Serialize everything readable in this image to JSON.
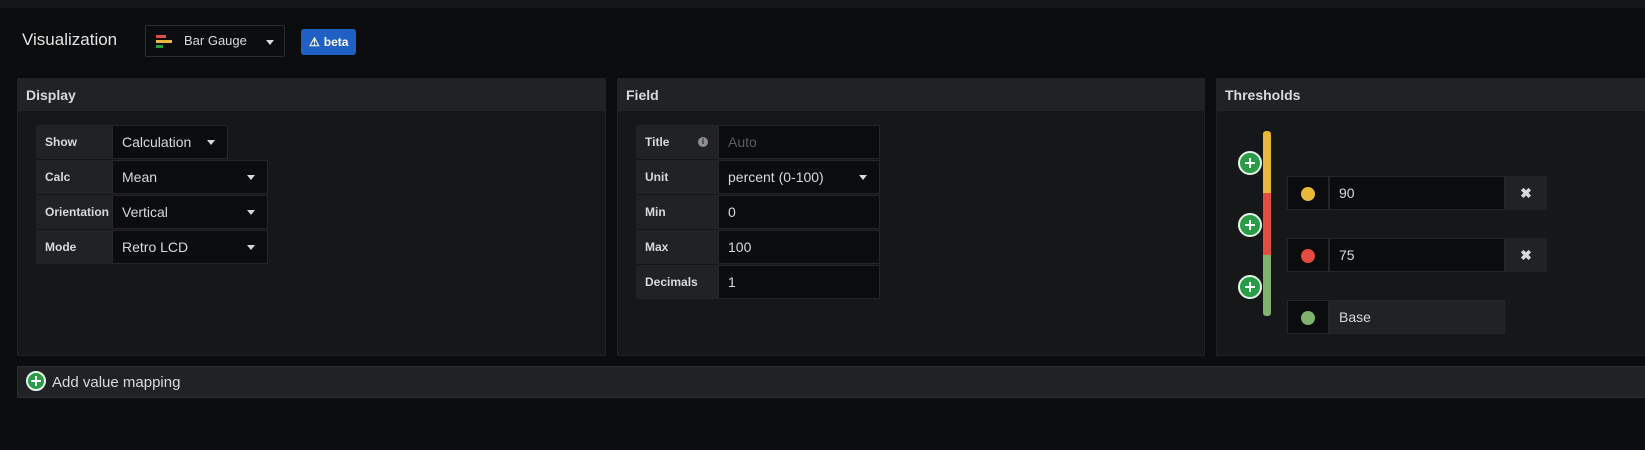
{
  "header": {
    "title": "Visualization",
    "visualization_select": {
      "value": "Bar Gauge",
      "icon": "bar-gauge-icon"
    },
    "beta_badge": "beta"
  },
  "display": {
    "title": "Display",
    "rows": [
      {
        "label": "Show",
        "value": "Calculation"
      },
      {
        "label": "Calc",
        "value": "Mean"
      },
      {
        "label": "Orientation",
        "value": "Vertical"
      },
      {
        "label": "Mode",
        "value": "Retro LCD"
      }
    ]
  },
  "field": {
    "title": "Field",
    "title_row": {
      "label": "Title",
      "placeholder": "Auto"
    },
    "unit": {
      "label": "Unit",
      "value": "percent (0-100)"
    },
    "min": {
      "label": "Min",
      "value": "0"
    },
    "max": {
      "label": "Max",
      "value": "100"
    },
    "decimals": {
      "label": "Decimals",
      "value": "1"
    }
  },
  "thresholds": {
    "title": "Thresholds",
    "items": [
      {
        "value": "90",
        "color": "#eab839"
      },
      {
        "value": "75",
        "color": "#e24d42"
      },
      {
        "value": "Base",
        "color": "#7eb26d"
      }
    ]
  },
  "mapping": {
    "label": "Add value mapping"
  },
  "colors": {
    "accent_blue": "#1f60c4",
    "add_green": "#299c46",
    "threshold_yellow": "#eab839",
    "threshold_red": "#e24d42",
    "threshold_green": "#7eb26d"
  }
}
